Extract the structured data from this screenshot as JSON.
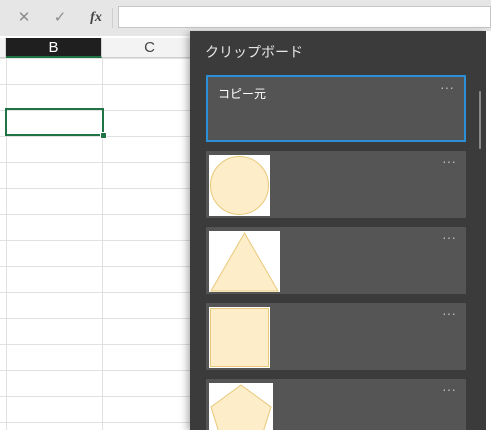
{
  "formula_bar": {
    "cancel_icon": "x-icon",
    "enter_icon": "check-icon",
    "fx_label": "fx",
    "value": ""
  },
  "columns": {
    "b": "B",
    "c": "C"
  },
  "clipboard": {
    "title": "クリップボード",
    "items": [
      {
        "type": "text",
        "text": "コピー元",
        "more": "···"
      },
      {
        "type": "image",
        "shape": "circle",
        "more": "···"
      },
      {
        "type": "image",
        "shape": "triangle",
        "more": "···"
      },
      {
        "type": "image",
        "shape": "square",
        "more": "···"
      },
      {
        "type": "image",
        "shape": "pentagon",
        "more": "···"
      }
    ]
  },
  "colors": {
    "shape_fill": "#fdedc8",
    "shape_stroke": "#e8c87a",
    "selection_green": "#217346",
    "pane_bg": "#3b3b3b",
    "item_bg": "#555555",
    "focus_blue": "#2d8fd5"
  }
}
